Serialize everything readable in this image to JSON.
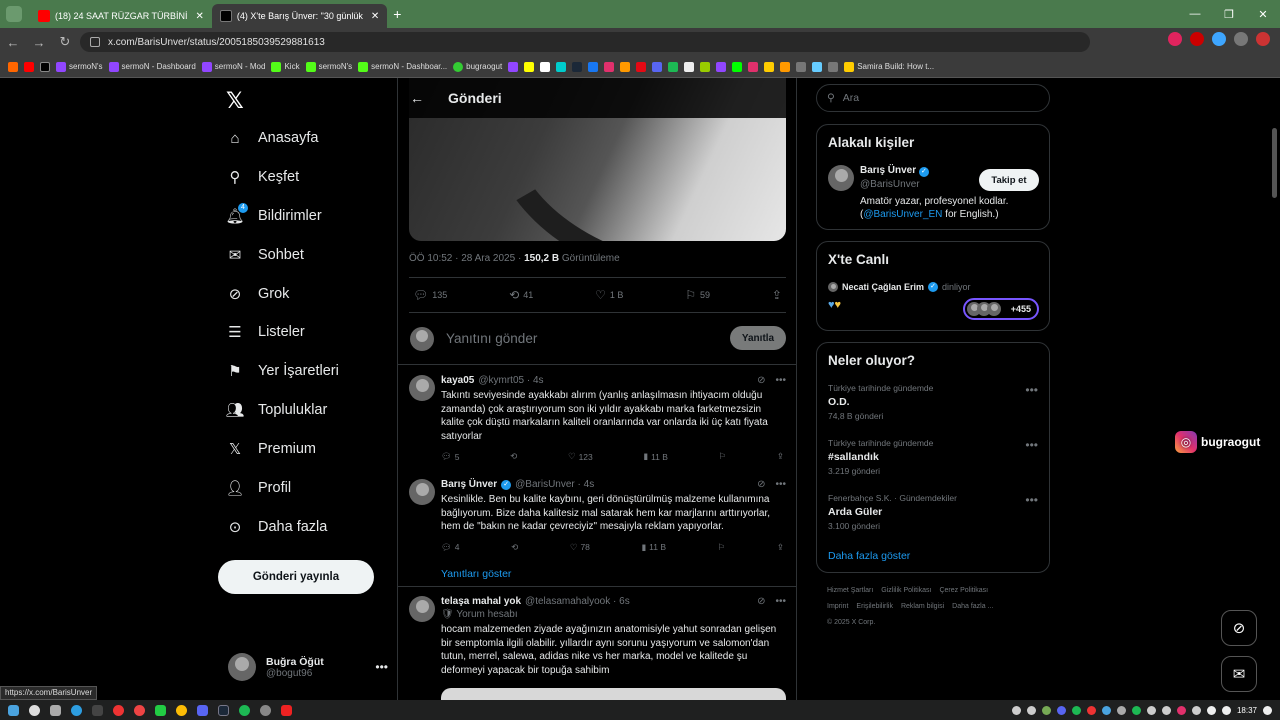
{
  "browser": {
    "tabs": [
      {
        "title": "(18) 24 SAAT RÜZGAR TÜRBİNİ",
        "color": "#ff0000"
      },
      {
        "title": "(4) X'te Barış Ünver: \"30 günlük",
        "color": "#000000"
      }
    ],
    "url": "x.com/BarisUnver/status/2005185039529881613",
    "bookmarks": [
      "sermoN's",
      "sermoN - Dashboard",
      "sermoN - Mod",
      "Kick",
      "sermoN's",
      "sermoN - Dashboar...",
      "bugraogut",
      "Samira Build: How t..."
    ],
    "status_url": "https://x.com/BarisUnver"
  },
  "nav": {
    "items": [
      "Anasayfa",
      "Keşfet",
      "Bildirimler",
      "Sohbet",
      "Grok",
      "Listeler",
      "Yer İşaretleri",
      "Topluluklar",
      "Premium",
      "Profil",
      "Daha fazla"
    ],
    "notif_count": "4",
    "post_button": "Gönderi yayınla",
    "user_name": "Buğra Öğüt",
    "user_handle": "@bogut96"
  },
  "post": {
    "header": "Gönderi",
    "meta_time": "ÖÖ 10:52 · 28 Ara 2025 · ",
    "meta_views": "150,2 B",
    "meta_views_label": " Görüntüleme",
    "replies": "135",
    "reposts": "41",
    "likes": "1 B",
    "bookmarks": "59",
    "reply_placeholder": "Yanıtını gönder",
    "reply_button": "Yanıtla"
  },
  "replies": [
    {
      "name": "kaya05",
      "handle": "@kymrt05 · 4s",
      "text": "Takıntı seviyesinde ayakkabı alırım (yanlış anlaşılmasın ihtiyacım olduğu zamanda) çok araştırıyorum son iki yıldır ayakkabı marka farketmezsizin kalite çok düştü markaların kaliteli oranlarında var onlarda iki üç katı fiyata satıyorlar",
      "replies": "5",
      "reposts": "",
      "likes": "123",
      "views": "11 B"
    },
    {
      "name": "Barış Ünver",
      "handle": "@BarisUnver · 4s",
      "text": "Kesinlikle. Ben bu kalite kaybını, geri dönüştürülmüş malzeme kullanımına bağlıyorum. Bize daha kalitesiz mal satarak hem kar marjlarını arttırıyorlar, hem de \"bakın ne kadar çevreciyiz\" mesajıyla reklam yapıyorlar.",
      "replies": "4",
      "reposts": "",
      "likes": "78",
      "views": "11 B"
    },
    {
      "name": "telaşa mahal yok",
      "handle": "@telasamahalyook · 6s",
      "sub": "Yorum hesabı",
      "text": "hocam malzemeden ziyade ayağınızın anatomisiyle yahut sonradan gelişen bir semptomla ilgili olabilir. yıllardır aynı sorunu yaşıyorum ve salomon'dan tutun, merrel, salewa, adidas nike vs her marka, model ve kalitede şu deformeyi yapacak bir topuğa sahibim"
    }
  ],
  "show_replies": "Yanıtları göster",
  "sidebar": {
    "search_placeholder": "Ara",
    "related_title": "Alakalı kişiler",
    "related_name": "Barış Ünver",
    "related_handle": "@BarisUnver",
    "follow": "Takip et",
    "bio_1": "Amatör yazar, profesyonel kodlar. (",
    "bio_link": "@BarisUnver_EN",
    "bio_2": " for English.)",
    "live_title": "X'te Canlı",
    "live_host": "Necati Çağlan Erim",
    "live_status": "dinliyor",
    "live_count": "+455",
    "trends_title": "Neler oluyor?",
    "trends": [
      {
        "cat": "Türkiye tarihinde gündemde",
        "topic": "O.D.",
        "posts": "74,8 B gönderi"
      },
      {
        "cat": "Türkiye tarihinde gündemde",
        "topic": "#sallandık",
        "posts": "3.219 gönderi"
      },
      {
        "cat": "Fenerbahçe S.K. · Gündemdekiler",
        "topic": "Arda Güler",
        "posts": "3.100 gönderi"
      }
    ],
    "show_more": "Daha fazla göster",
    "footer": [
      "Hizmet Şartları",
      "Gizlilik Politikası",
      "Çerez Politikası",
      "Imprint",
      "Erişilebilirlik",
      "Reklam bilgisi",
      "Daha fazla ...",
      "© 2025 X Corp."
    ]
  },
  "overlay": {
    "instagram": "bugraogut"
  },
  "taskbar": {
    "time": "18:37"
  }
}
